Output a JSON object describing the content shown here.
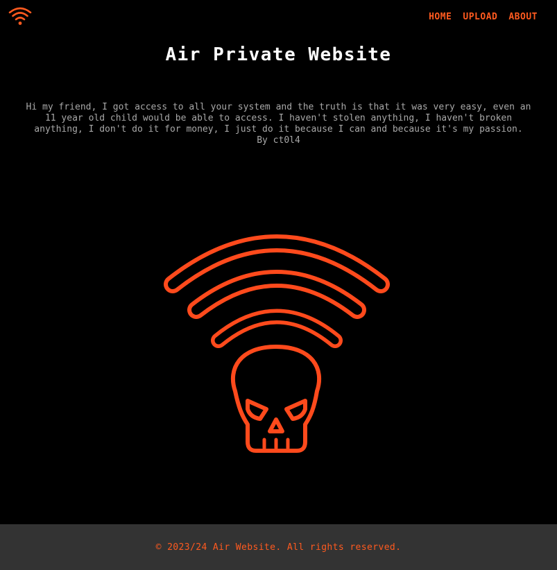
{
  "header": {
    "logo_icon": "wifi-icon",
    "nav": [
      "HOME",
      "UPLOAD",
      "ABOUT"
    ]
  },
  "main": {
    "title": "Air Private Website",
    "message": "Hi my friend, I got access to all your system and the truth is that it was very easy, even an 11 year old child would be able to access. I haven't stolen anything, I haven't broken anything, I don't do it for money, I just do it because I can and because it's my passion.",
    "byline": "By ct0l4",
    "hero_icon": "wifi-skull-icon"
  },
  "footer": {
    "copyright": "© 2023/24 Air Website. All rights reserved."
  },
  "colors": {
    "accent": "#ff5a1f",
    "background": "#000000",
    "footer_bg": "#333333",
    "text": "#a8a8a8",
    "title": "#ffffff"
  }
}
